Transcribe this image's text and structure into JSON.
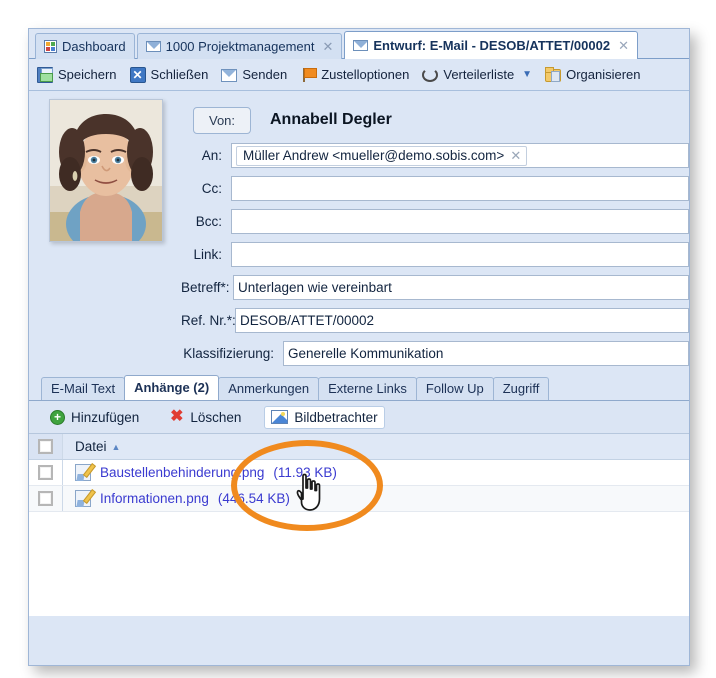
{
  "window": {
    "tabs": [
      {
        "label": "Dashboard",
        "icon": "dashboard-icon",
        "closable": false,
        "active": false
      },
      {
        "label": "1000 Projektmanagement",
        "icon": "envelope-icon",
        "close_label": "✕",
        "closable": true,
        "active": false
      },
      {
        "label": "Entwurf: E-Mail - DESOB/ATTET/00002",
        "icon": "envelope-icon",
        "close_label": "✕",
        "closable": true,
        "active": true
      }
    ]
  },
  "toolbar": {
    "items": [
      {
        "label": "Speichern",
        "icon": "save-icon",
        "has_caret": false
      },
      {
        "label": "Schließen",
        "icon": "close-x-icon",
        "glyph": "✕",
        "has_caret": false
      },
      {
        "label": "Senden",
        "icon": "envelope-icon",
        "has_caret": false
      },
      {
        "label": "Zustelloptionen",
        "icon": "flag-icon",
        "has_caret": false
      },
      {
        "label": "Verteilerliste",
        "icon": "distribution-list-icon",
        "has_caret": true,
        "caret": "▼"
      },
      {
        "label": "Organisieren",
        "icon": "folder-lock-icon",
        "has_caret": false
      }
    ]
  },
  "form": {
    "from_button_label": "Von:",
    "from_name": "Annabell Degler",
    "fields": [
      {
        "key": "an",
        "label": "An:",
        "value": "Müller Andrew <mueller@demo.sobis.com>",
        "is_token": true,
        "token_remove": "✕"
      },
      {
        "key": "cc",
        "label": "Cc:",
        "value": "",
        "is_token": false
      },
      {
        "key": "bcc",
        "label": "Bcc:",
        "value": "",
        "is_token": false
      },
      {
        "key": "link",
        "label": "Link:",
        "value": "",
        "is_token": false
      },
      {
        "key": "betreff",
        "label": "Betreff*:",
        "value": "Unterlagen wie vereinbart",
        "is_token": false
      },
      {
        "key": "refnr",
        "label": "Ref. Nr.*:",
        "value": "DESOB/ATTET/00002",
        "is_token": false
      },
      {
        "key": "klassifizierung",
        "label": "Klassifizierung:",
        "value": "Generelle Kommunikation",
        "is_token": false
      }
    ]
  },
  "subtabs": [
    {
      "label": "E-Mail Text",
      "active": false
    },
    {
      "label": "Anhänge (2)",
      "active": true
    },
    {
      "label": "Anmerkungen",
      "active": false
    },
    {
      "label": "Externe Links",
      "active": false
    },
    {
      "label": "Follow Up",
      "active": false
    },
    {
      "label": "Zugriff",
      "active": false
    }
  ],
  "attachments": {
    "toolbar": [
      {
        "label": "Hinzufügen",
        "icon": "plus-circle-icon",
        "highlighted": false
      },
      {
        "label": "Löschen",
        "icon": "red-x-icon",
        "glyph": "✖",
        "highlighted": false
      },
      {
        "label": "Bildbetrachter",
        "icon": "image-viewer-icon",
        "highlighted": true
      }
    ],
    "column_header": "Datei",
    "sort_indicator": "▲",
    "rows": [
      {
        "name": "Baustellenbehinderung.png",
        "size": "(11.93 KB)",
        "icon": "file-edit-icon",
        "checked": false
      },
      {
        "name": "Informationen.png",
        "size": "(446.54 KB)",
        "icon": "file-edit-icon",
        "checked": false
      }
    ]
  },
  "annotation": {
    "shape": "ellipse",
    "color": "#f08a1e",
    "target": "Bildbetrachter",
    "cursor": "pointing-hand"
  }
}
